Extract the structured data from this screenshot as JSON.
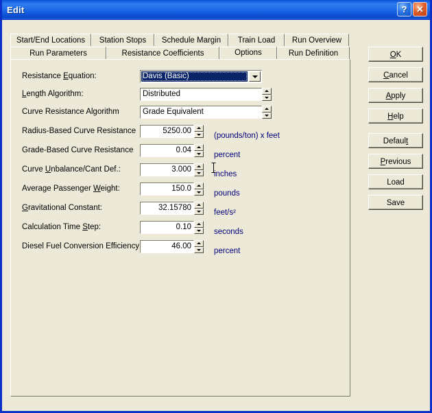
{
  "window": {
    "title": "Edit",
    "help_button": "?",
    "close_button": "✕",
    "accent_titlebar": "#1f6ce8",
    "face_color": "#ece9d8",
    "unit_text_color": "#00007a",
    "selection_color": "#0a246a"
  },
  "tabs": {
    "row1": [
      {
        "label": "Start/End Locations",
        "selected": false
      },
      {
        "label": "Station Stops",
        "selected": false
      },
      {
        "label": "Schedule Margin",
        "selected": false
      },
      {
        "label": "Train Load",
        "selected": false
      },
      {
        "label": "Run Overview",
        "selected": false
      }
    ],
    "row2": [
      {
        "label": "Run Parameters",
        "selected": false
      },
      {
        "label": "Resistance Coefficients",
        "selected": false
      },
      {
        "label": "Options",
        "selected": true
      },
      {
        "label": "Run Definition",
        "selected": false
      }
    ]
  },
  "fields": [
    {
      "label_pre": "Resistance ",
      "accel": "E",
      "label_post": "quation:",
      "type": "combo",
      "value": "Davis (Basic)",
      "unit": "",
      "selected": true
    },
    {
      "label_pre": "",
      "accel": "L",
      "label_post": "ength Algorithm:",
      "type": "text",
      "value": "Distributed",
      "unit": ""
    },
    {
      "label_pre": "Curve Resistance Algorithm",
      "accel": "",
      "label_post": "",
      "type": "text",
      "value": "Grade Equivalent",
      "unit": ""
    },
    {
      "label_pre": "Radius-Based Curve Resistance",
      "accel": "",
      "label_post": "",
      "type": "number",
      "value": "5250.00",
      "unit": "(pounds/ton) x feet"
    },
    {
      "label_pre": "Grade-Based Curve Resistance",
      "accel": "",
      "label_post": "",
      "type": "number",
      "value": "0.04",
      "unit": "percent"
    },
    {
      "label_pre": "Curve ",
      "accel": "U",
      "label_post": "nbalance/Cant Def.:",
      "type": "number",
      "value": "3.000",
      "unit": "inches"
    },
    {
      "label_pre": "Average Passenger ",
      "accel": "W",
      "label_post": "eight:",
      "type": "number",
      "value": "150.0",
      "unit": "pounds"
    },
    {
      "label_pre": "",
      "accel": "G",
      "label_post": "ravitational Constant:",
      "type": "number",
      "value": "32.15780",
      "unit": "feet/s²"
    },
    {
      "label_pre": "Calculation Time ",
      "accel": "S",
      "label_post": "tep:",
      "type": "number",
      "value": "0.10",
      "unit": "seconds"
    },
    {
      "label_pre": "Diesel Fuel Conversion Efficiency",
      "accel": "",
      "label_post": "",
      "type": "number",
      "value": "46.00",
      "unit": "percent"
    }
  ],
  "buttons": [
    {
      "name": "ok",
      "pre": "",
      "accel": "O",
      "post": "K"
    },
    {
      "name": "cancel",
      "pre": "",
      "accel": "C",
      "post": "ancel"
    },
    {
      "name": "apply",
      "pre": "",
      "accel": "A",
      "post": "pply"
    },
    {
      "name": "help",
      "pre": "",
      "accel": "H",
      "post": "elp"
    },
    {
      "name": "default",
      "pre": "Defaul",
      "accel": "t",
      "post": ""
    },
    {
      "name": "previous",
      "pre": "",
      "accel": "P",
      "post": "revious"
    },
    {
      "name": "load",
      "pre": "Load",
      "accel": "",
      "post": ""
    },
    {
      "name": "save",
      "pre": "Save",
      "accel": "",
      "post": ""
    }
  ]
}
